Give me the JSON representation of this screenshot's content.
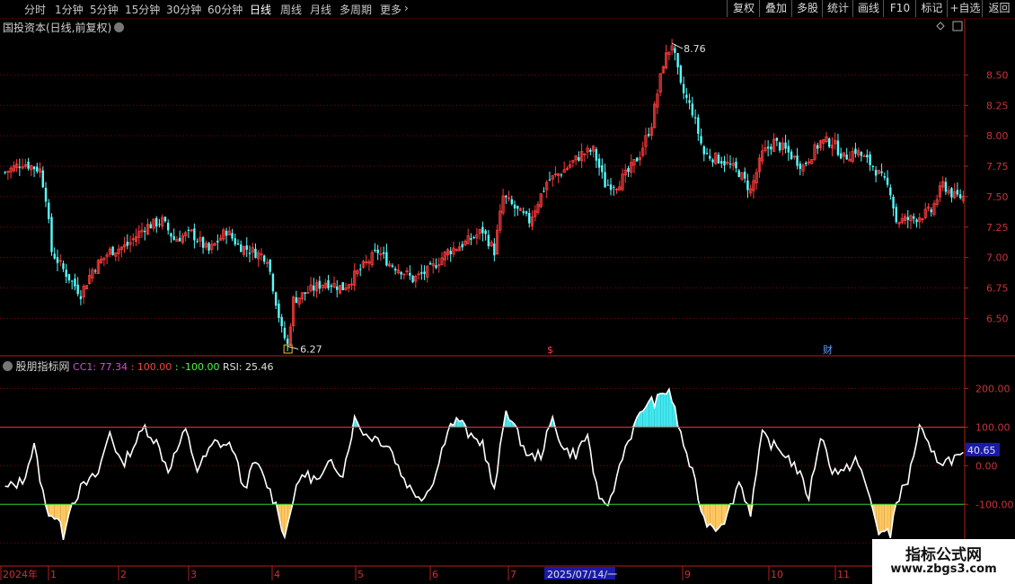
{
  "toolbar": {
    "periods": [
      "分时",
      "1分钟",
      "5分钟",
      "15分钟",
      "30分钟",
      "60分钟",
      "日线",
      "周线",
      "月线",
      "多周期",
      "更多"
    ],
    "active_period": "日线",
    "more_arrow": "›",
    "right_buttons": [
      "复权",
      "叠加",
      "多股",
      "统计",
      "画线",
      "F10",
      "标记",
      "+自选",
      "返回"
    ]
  },
  "main": {
    "title": "国投资本(日线,前复权)",
    "price_ticks": [
      "8.50",
      "8.25",
      "8.00",
      "7.75",
      "7.50",
      "7.25",
      "7.00",
      "6.75",
      "6.50"
    ],
    "high_label": "8.76",
    "low_label": "6.27",
    "event_marks": [
      "$",
      "财"
    ]
  },
  "indicator": {
    "name": "股朋指标网",
    "cc1_label": "CC1: 77.34",
    "v100_label": ": 100.00",
    "vm100_label": ": -100.00",
    "rsi_label": "RSI: 25.46",
    "y_ticks": [
      "200.00",
      "100.00",
      "0.00",
      "-100.00",
      "-200.00"
    ],
    "cursor_value": "40.65"
  },
  "xaxis": {
    "labels": [
      "2024年",
      "1",
      "2",
      "3",
      "4",
      "5",
      "6",
      "7",
      "8",
      "9",
      "10",
      "11"
    ],
    "highlight_label": "2025/07/14/一"
  },
  "watermark": {
    "line1": "指标公式网",
    "line2": "www.zbgs3.com"
  },
  "colors": {
    "up": "#ff3c3c",
    "down": "#55ffff",
    "grid": "#8a0000",
    "cc1": "#ffffff",
    "fill_pos": "#40e8f0",
    "fill_neg": "#ffc860"
  },
  "chart_data": {
    "type": "candlestick+line",
    "price_range": [
      6.2,
      8.85
    ],
    "close_anchors": [
      [
        0,
        7.7
      ],
      [
        6,
        7.78
      ],
      [
        12,
        7.72
      ],
      [
        14,
        7.5
      ],
      [
        16,
        7.05
      ],
      [
        20,
        6.9
      ],
      [
        26,
        6.7
      ],
      [
        30,
        6.9
      ],
      [
        36,
        7.05
      ],
      [
        42,
        7.1
      ],
      [
        48,
        7.25
      ],
      [
        54,
        7.3
      ],
      [
        58,
        7.15
      ],
      [
        64,
        7.2
      ],
      [
        70,
        7.05
      ],
      [
        76,
        7.22
      ],
      [
        80,
        7.1
      ],
      [
        85,
        7.05
      ],
      [
        90,
        7.0
      ],
      [
        95,
        6.4
      ],
      [
        97,
        6.28
      ],
      [
        99,
        6.65
      ],
      [
        104,
        6.72
      ],
      [
        110,
        6.8
      ],
      [
        116,
        6.75
      ],
      [
        122,
        6.9
      ],
      [
        128,
        7.05
      ],
      [
        132,
        6.95
      ],
      [
        136,
        6.9
      ],
      [
        140,
        6.82
      ],
      [
        146,
        6.9
      ],
      [
        152,
        7.05
      ],
      [
        158,
        7.12
      ],
      [
        164,
        7.22
      ],
      [
        168,
        7.05
      ],
      [
        171,
        7.5
      ],
      [
        176,
        7.38
      ],
      [
        180,
        7.3
      ],
      [
        186,
        7.62
      ],
      [
        192,
        7.72
      ],
      [
        198,
        7.85
      ],
      [
        202,
        7.88
      ],
      [
        206,
        7.6
      ],
      [
        210,
        7.6
      ],
      [
        214,
        7.7
      ],
      [
        218,
        7.85
      ],
      [
        222,
        8.1
      ],
      [
        226,
        8.6
      ],
      [
        229,
        8.76
      ],
      [
        232,
        8.4
      ],
      [
        236,
        8.2
      ],
      [
        240,
        7.85
      ],
      [
        246,
        7.8
      ],
      [
        252,
        7.7
      ],
      [
        256,
        7.55
      ],
      [
        260,
        7.85
      ],
      [
        264,
        7.95
      ],
      [
        268,
        7.88
      ],
      [
        274,
        7.75
      ],
      [
        280,
        7.95
      ],
      [
        284,
        7.95
      ],
      [
        288,
        7.82
      ],
      [
        292,
        7.88
      ],
      [
        298,
        7.75
      ],
      [
        304,
        7.55
      ],
      [
        306,
        7.3
      ],
      [
        312,
        7.32
      ],
      [
        318,
        7.38
      ],
      [
        322,
        7.6
      ],
      [
        326,
        7.5
      ]
    ],
    "cc1_anchors": [
      [
        0,
        -60
      ],
      [
        6,
        -40
      ],
      [
        10,
        50
      ],
      [
        14,
        -110
      ],
      [
        18,
        -140
      ],
      [
        20,
        -180
      ],
      [
        22,
        -110
      ],
      [
        26,
        -60
      ],
      [
        32,
        -20
      ],
      [
        36,
        90
      ],
      [
        40,
        0
      ],
      [
        44,
        50
      ],
      [
        48,
        100
      ],
      [
        52,
        60
      ],
      [
        56,
        -10
      ],
      [
        62,
        90
      ],
      [
        66,
        -10
      ],
      [
        72,
        60
      ],
      [
        78,
        50
      ],
      [
        82,
        -60
      ],
      [
        86,
        10
      ],
      [
        90,
        -50
      ],
      [
        94,
        -120
      ],
      [
        96,
        -190
      ],
      [
        98,
        -110
      ],
      [
        102,
        -20
      ],
      [
        108,
        -40
      ],
      [
        112,
        10
      ],
      [
        116,
        -20
      ],
      [
        120,
        120
      ],
      [
        124,
        80
      ],
      [
        128,
        70
      ],
      [
        132,
        50
      ],
      [
        136,
        -20
      ],
      [
        140,
        -70
      ],
      [
        144,
        -80
      ],
      [
        148,
        -20
      ],
      [
        152,
        100
      ],
      [
        156,
        120
      ],
      [
        160,
        70
      ],
      [
        164,
        60
      ],
      [
        168,
        -70
      ],
      [
        172,
        150
      ],
      [
        176,
        80
      ],
      [
        180,
        20
      ],
      [
        184,
        30
      ],
      [
        188,
        120
      ],
      [
        192,
        40
      ],
      [
        196,
        30
      ],
      [
        200,
        80
      ],
      [
        204,
        -100
      ],
      [
        208,
        -90
      ],
      [
        212,
        30
      ],
      [
        216,
        100
      ],
      [
        220,
        160
      ],
      [
        224,
        170
      ],
      [
        228,
        200
      ],
      [
        232,
        80
      ],
      [
        236,
        -20
      ],
      [
        240,
        -140
      ],
      [
        244,
        -160
      ],
      [
        248,
        -130
      ],
      [
        252,
        -40
      ],
      [
        256,
        -120
      ],
      [
        260,
        80
      ],
      [
        264,
        50
      ],
      [
        268,
        30
      ],
      [
        272,
        -10
      ],
      [
        276,
        -80
      ],
      [
        280,
        80
      ],
      [
        284,
        -10
      ],
      [
        288,
        -20
      ],
      [
        292,
        20
      ],
      [
        296,
        -60
      ],
      [
        300,
        -170
      ],
      [
        304,
        -180
      ],
      [
        306,
        -90
      ],
      [
        310,
        -40
      ],
      [
        314,
        100
      ],
      [
        318,
        30
      ],
      [
        322,
        10
      ],
      [
        326,
        20
      ]
    ],
    "fill_threshold_pos": 100,
    "fill_threshold_neg": -100,
    "indicator_range": [
      -260,
      280
    ]
  }
}
